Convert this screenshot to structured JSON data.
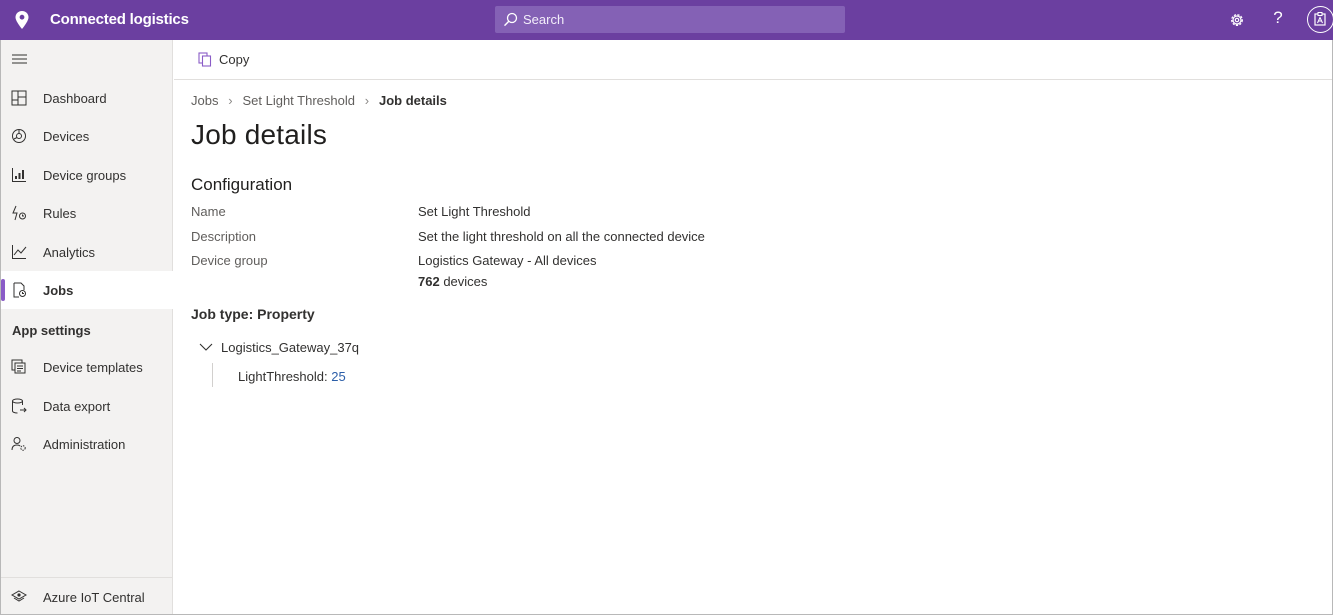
{
  "app": {
    "title": "Connected logistics"
  },
  "search": {
    "placeholder": "Search"
  },
  "header_icons": [
    "location-pin-icon",
    "search-icon",
    "gear-icon",
    "help-icon",
    "avatar-icon"
  ],
  "sidebar": {
    "items": [
      {
        "label": "Dashboard",
        "icon": "dashboard-icon"
      },
      {
        "label": "Devices",
        "icon": "devices-icon"
      },
      {
        "label": "Device groups",
        "icon": "device-groups-icon"
      },
      {
        "label": "Rules",
        "icon": "rules-icon"
      },
      {
        "label": "Analytics",
        "icon": "analytics-icon"
      },
      {
        "label": "Jobs",
        "icon": "jobs-icon",
        "active": true
      }
    ],
    "section_label": "App settings",
    "settings_items": [
      {
        "label": "Device templates",
        "icon": "device-templates-icon"
      },
      {
        "label": "Data export",
        "icon": "data-export-icon"
      },
      {
        "label": "Administration",
        "icon": "administration-icon"
      }
    ],
    "footer": {
      "label": "Azure IoT Central",
      "icon": "iot-central-icon"
    }
  },
  "toolbar": {
    "copy_label": "Copy"
  },
  "breadcrumb": [
    "Jobs",
    "Set Light Threshold",
    "Job details"
  ],
  "page": {
    "title": "Job details",
    "configuration_title": "Configuration",
    "properties": [
      {
        "label": "Name",
        "value": "Set Light Threshold"
      },
      {
        "label": "Description",
        "value": "Set the light threshold on all the connected device"
      },
      {
        "label": "Device group",
        "value": "Logistics Gateway - All devices"
      }
    ],
    "device_count": "762",
    "device_count_unit": " devices",
    "job_type": "Job type: Property",
    "tree": {
      "node": "Logistics_Gateway_37q",
      "leaf_label": "LightThreshold: ",
      "leaf_value": "25"
    }
  },
  "colors": {
    "header": "#6b3fa0",
    "search": "#8461b5",
    "active_accent": "#8a5cc7",
    "sidebar_bg": "#f3f2f1",
    "link": "#2b5ea8"
  }
}
